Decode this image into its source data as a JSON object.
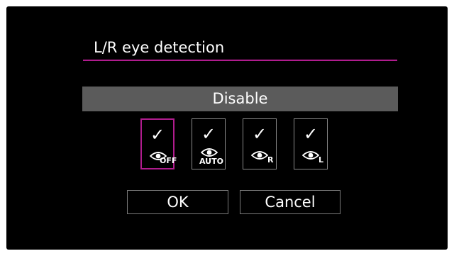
{
  "dialog": {
    "title": "L/R eye detection",
    "current_setting": "Disable"
  },
  "options": [
    {
      "id": "off",
      "check": "✓",
      "badge": "OFF",
      "selected": true
    },
    {
      "id": "auto",
      "check": "✓",
      "badge": "AUTO",
      "selected": false
    },
    {
      "id": "right",
      "check": "✓",
      "badge": "R",
      "selected": false
    },
    {
      "id": "left",
      "check": "✓",
      "badge": "L",
      "selected": false
    }
  ],
  "buttons": {
    "ok_label": "OK",
    "cancel_label": "Cancel"
  },
  "colors": {
    "background": "#000000",
    "accent": "#b01c8e",
    "selection_bar": "#5b5b5b"
  },
  "icons": [
    "check-icon",
    "eye-detect-off-icon",
    "eye-detect-auto-icon",
    "eye-detect-right-icon",
    "eye-detect-left-icon"
  ]
}
